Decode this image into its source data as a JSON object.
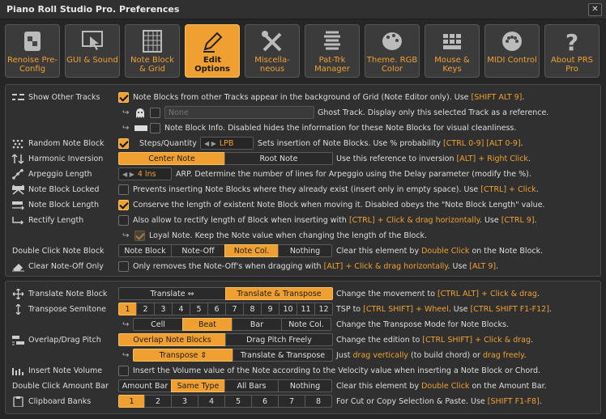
{
  "window": {
    "title": "Piano Roll Studio Pro.  Preferences",
    "close": "✕"
  },
  "tabs": [
    {
      "label": "Renoise Pre-Config",
      "icon": "renoise-logo-icon"
    },
    {
      "label": "GUI & Sound",
      "icon": "monitor-cursor-icon"
    },
    {
      "label": "Note Block & Grid",
      "icon": "grid-icon"
    },
    {
      "label": "Edit Options",
      "icon": "pencil-icon",
      "active": true
    },
    {
      "label": "Miscella-neous",
      "icon": "tools-icon"
    },
    {
      "label": "Pat-Trk Manager",
      "icon": "pattern-track-icon"
    },
    {
      "label": "Theme. RGB Color",
      "icon": "palette-icon"
    },
    {
      "label": "Mouse & Keys",
      "icon": "mouse-keys-icon"
    },
    {
      "label": "MIDI Control",
      "icon": "midi-connector-icon"
    },
    {
      "label": "About PRS Pro",
      "icon": "question-mark-icon"
    }
  ],
  "colors": {
    "accent": "#f0a030",
    "bg": "#262626",
    "panel": "#303030"
  },
  "rows": {
    "show_other": {
      "label": "Show Other Tracks",
      "checked": true,
      "text": "Note Blocks from other Tracks appear in the background of Grid (Note Editor only). Use ",
      "key": "[SHIFT ALT 9]",
      "tail": "."
    },
    "ghost": {
      "field": "None",
      "text": "Ghost Track. Display only this selected Track as a reference."
    },
    "info": {
      "text": "Note Block Info. Disabled hides the information for these Note Blocks for visual cleanliness."
    },
    "random": {
      "label": "Random Note Block",
      "checked": true,
      "steps_label": "Steps/Quantity",
      "steps_value": "LPB",
      "text": "Sets insertion of Note Blocks. Use % probability ",
      "key": "[CTRL 0-9] [ALT 0-9]",
      "tail": "."
    },
    "harmonic": {
      "label": "Harmonic Inversion",
      "options": [
        "Center Note",
        "Root Note"
      ],
      "selected": 0,
      "text": "Use this reference to inversion ",
      "key": "[ALT] + Right Click",
      "tail": "."
    },
    "arpeggio": {
      "label": "Arpeggio Length",
      "value": "4 lns",
      "text": "ARP. Determine the number of lines for Arpeggio using the Delay parameter (modify the %)."
    },
    "locked": {
      "label": "Note Block Locked",
      "checked": false,
      "text": "Prevents inserting Note Blocks where they already exist (insert only in empty space). Use ",
      "key": "[CTRL] + Click",
      "tail": "."
    },
    "length": {
      "label": "Note Block Length",
      "checked": true,
      "text": "Conserve the length of existent Note Block when moving it. Disabled obeys the \"Note Block Length\" value."
    },
    "rectify": {
      "label": "Rectify Length",
      "checked": false,
      "text": "Also allow to rectify length of Block when inserting with ",
      "key": "[CTRL] + Click & drag horizontally",
      "mid": ". Use ",
      "key2": "[CTRL 9]",
      "tail": "."
    },
    "loyal": {
      "text": "Loyal Note. Keep the Note value when changing the length of the Block."
    },
    "dblclick": {
      "label": "Double Click Note Block",
      "options": [
        "Note Block",
        "Note-Off",
        "Note Col.",
        "Nothing"
      ],
      "selected": 2,
      "text": "Clear this element by ",
      "key": "Double Click",
      "tail": " on the Note Block."
    },
    "clearoff": {
      "label": "Clear Note-Off Only",
      "checked": false,
      "text": "Only removes the Note-Off's when dragging with ",
      "key": "[ALT] + Click & drag horizontally",
      "mid": ". Use ",
      "key2": "[ALT 9]",
      "tail": "."
    },
    "translate": {
      "label": "Translate Note Block",
      "options": [
        "Translate ⇔",
        "Translate & Transpose"
      ],
      "selected": 1,
      "text": "Change the movement to ",
      "key": "[CTRL ALT] + Click & drag",
      "tail": "."
    },
    "semitone": {
      "label": "Transpose Semitone",
      "options": [
        "1",
        "2",
        "3",
        "4",
        "5",
        "6",
        "7",
        "8",
        "9",
        "10",
        "11",
        "12"
      ],
      "selected": 0,
      "text": "TSP to ",
      "key": "[CTRL SHIFT] + Wheel",
      "mid": ". Use ",
      "key2": "[CTRL SHIFT F1-F12]",
      "tail": "."
    },
    "mode": {
      "options": [
        "Cell",
        "Beat",
        "Bar",
        "Note Col."
      ],
      "selected": 1,
      "text": "Change the Transpose Mode for Note Blocks."
    },
    "overlap": {
      "label": "Overlap/Drag Pitch",
      "options": [
        "Overlap Note Blocks",
        "Drag Pitch Freely"
      ],
      "selected": 0,
      "text": "Change the edition to ",
      "key": "[CTRL SHIFT] + Click & drag",
      "tail": "."
    },
    "transpose": {
      "options": [
        "Transpose ⇕",
        "Translate & Transpose"
      ],
      "selected": 0,
      "text": "Just ",
      "key": "drag vertically",
      "mid": " (to build chord) or ",
      "key2": "drag freely",
      "tail": "."
    },
    "volume": {
      "label": "Insert Note Volume",
      "checked": false,
      "text": "Insert the Volume value of the Note according to the Velocity value when inserting a Note Block or Chord."
    },
    "amount": {
      "label": "Double Click Amount Bar",
      "options": [
        "Amount Bar",
        "Same Type",
        "All Bars",
        "Nothing"
      ],
      "selected": 1,
      "text": "Clear this element by ",
      "key": "Double Click",
      "tail": " on the Amount Bar."
    },
    "banks": {
      "label": "Clipboard Banks",
      "options": [
        "1",
        "2",
        "3",
        "4",
        "5",
        "6",
        "7",
        "8"
      ],
      "selected": 0,
      "text": "For Cut or Copy Selection & Paste. Use ",
      "key": "[SHIFT F1-F8]",
      "tail": "."
    }
  }
}
